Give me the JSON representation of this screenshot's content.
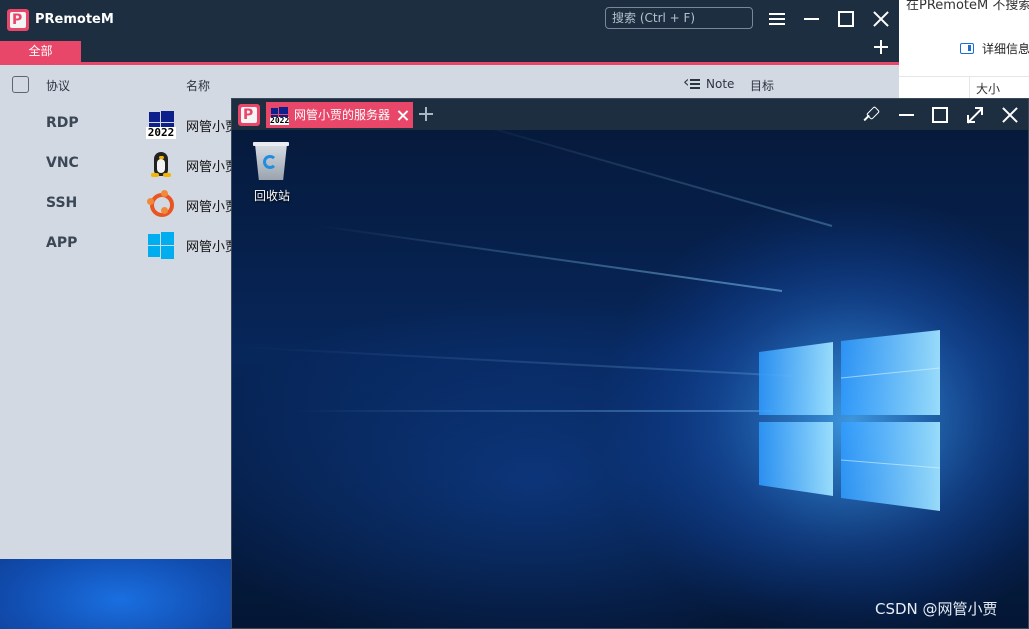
{
  "background_explorer": {
    "title_fragment": "在PRemoteM 不搜索",
    "details_label": "详细信息",
    "column_size": "大小"
  },
  "main": {
    "app_title": "PRemoteM",
    "search_placeholder": "搜索 (Ctrl + F)",
    "tags": [
      "全部"
    ],
    "list_header": {
      "protocol": "协议",
      "name": "名称",
      "note": "Note",
      "target": "目标"
    },
    "rows": [
      {
        "protocol": "RDP",
        "name": "网管小贾的服务器",
        "icon": "windows-2022-icon"
      },
      {
        "protocol": "VNC",
        "name": "网管小贾的服务器",
        "icon": "linux-tux-icon"
      },
      {
        "protocol": "SSH",
        "name": "网管小贾的服务器",
        "icon": "ubuntu-icon"
      },
      {
        "protocol": "APP",
        "name": "网管小贾的服务器",
        "icon": "windows-icon"
      }
    ]
  },
  "remote": {
    "tab_label": "网管小贾的服务器",
    "tab_icon_text": "2022",
    "desktop_icon_label": "回收站"
  },
  "watermark": "CSDN @网管小贾",
  "colors": {
    "accent": "#e8476a",
    "titlebar": "#1c2e3f",
    "list_bg": "#d3d9e3"
  }
}
